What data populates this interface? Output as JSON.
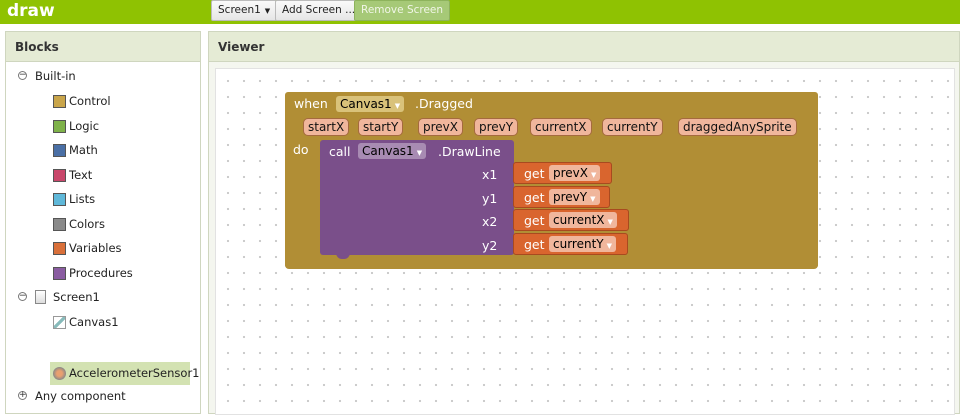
{
  "app": {
    "title": "draw"
  },
  "toolbar": {
    "screen_select": "Screen1",
    "add_screen": "Add Screen ...",
    "remove_screen": "Remove Screen"
  },
  "blocks_panel": {
    "title": "Blocks",
    "builtin_label": "Built-in",
    "builtin_items": [
      {
        "label": "Control",
        "color": "#c9a54a"
      },
      {
        "label": "Logic",
        "color": "#7fb24a"
      },
      {
        "label": "Math",
        "color": "#4a6fa5"
      },
      {
        "label": "Text",
        "color": "#c9476b"
      },
      {
        "label": "Lists",
        "color": "#5fb8d9"
      },
      {
        "label": "Colors",
        "color": "#8a8a8a"
      },
      {
        "label": "Variables",
        "color": "#d9703a"
      },
      {
        "label": "Procedures",
        "color": "#8a5ca1"
      }
    ],
    "screen_label": "Screen1",
    "components": [
      "Canvas1",
      "AccelerometerSensor1"
    ],
    "any_component": "Any component"
  },
  "viewer": {
    "title": "Viewer",
    "event_block": {
      "when": "when",
      "component": "Canvas1",
      "event": ".Dragged",
      "params": [
        "startX",
        "startY",
        "prevX",
        "prevY",
        "currentX",
        "currentY",
        "draggedAnySprite"
      ],
      "do": "do"
    },
    "call_block": {
      "call": "call",
      "component": "Canvas1",
      "method": ".DrawLine",
      "args": [
        {
          "name": "x1",
          "get": "get",
          "value": "prevX"
        },
        {
          "name": "y1",
          "get": "get",
          "value": "prevY"
        },
        {
          "name": "x2",
          "get": "get",
          "value": "currentX"
        },
        {
          "name": "y2",
          "get": "get",
          "value": "currentY"
        }
      ]
    }
  }
}
